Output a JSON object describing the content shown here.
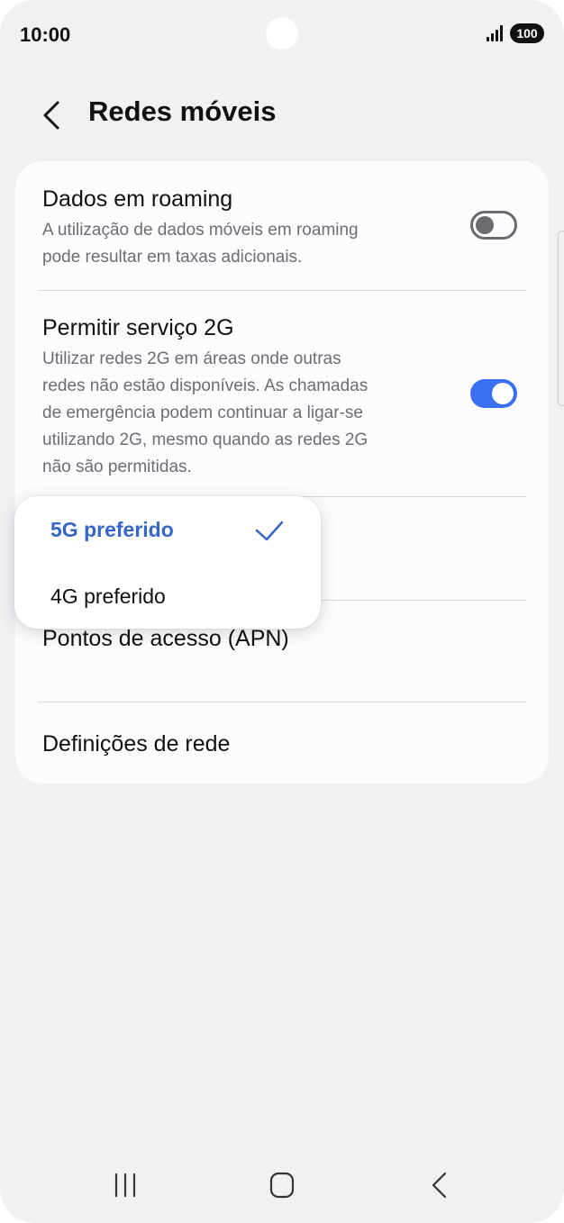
{
  "status_bar": {
    "time": "10:00",
    "battery": "100",
    "signal_icon": "cell-signal-icon"
  },
  "header": {
    "title": "Redes móveis",
    "back_icon": "chevron-left-icon"
  },
  "settings": {
    "roaming": {
      "title": "Dados em roaming",
      "subtitle_lines": [
        "A utilização de dados móveis em roaming",
        "pode resultar em taxas adicionais."
      ],
      "enabled": false
    },
    "allow_2g": {
      "title": "Permitir serviço 2G",
      "subtitle_lines": [
        "Utilizar redes 2G em áreas onde outras",
        "redes não estão disponíveis. As chamadas",
        "de emergência podem continuar a ligar-se",
        "utilizando 2G, mesmo quando as redes 2G",
        "não são permitidas."
      ],
      "enabled": true
    },
    "apn": {
      "title": "Pontos de acesso (APN)"
    },
    "network_settings": {
      "title": "Definições de rede"
    }
  },
  "network_mode_popup": {
    "options": [
      "5G preferido",
      "4G preferido"
    ],
    "selected": "5G preferido"
  },
  "colors": {
    "accent": "#3a6ff2",
    "selected_text": "#3567c8",
    "background": "#f1f1f4",
    "card": "#fcfcfe"
  },
  "nav_bar": {
    "recents_icon": "recents-icon",
    "home_icon": "home-icon",
    "back_icon": "back-icon"
  }
}
